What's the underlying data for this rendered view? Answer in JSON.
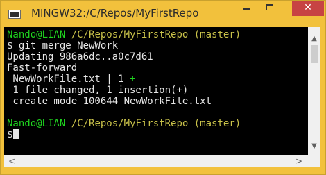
{
  "window": {
    "title": "MINGW32:/C/Repos/MyFirstRepo",
    "icon": "terminal-icon",
    "controls": {
      "minimize": "minimize-icon",
      "maximize": "maximize-icon",
      "close": "close-icon",
      "close_glyph": "✕"
    },
    "titlebar_color": "#f2c13c",
    "close_color": "#c74343"
  },
  "terminal": {
    "background": "#000000",
    "lines": [
      {
        "user": "Nando@LIAN",
        "path": "/C/Repos/MyFirstRepo",
        "branch": "(master)"
      },
      {
        "text": "$ git merge NewWork"
      },
      {
        "text": "Updating 986a6dc..a0c7d61"
      },
      {
        "text": "Fast-forward"
      },
      {
        "text": " NewWorkFile.txt | 1 ",
        "plus": "+"
      },
      {
        "text": " 1 file changed, 1 insertion(+)"
      },
      {
        "text": " create mode 100644 NewWorkFile.txt"
      },
      {
        "text": ""
      },
      {
        "user": "Nando@LIAN",
        "path": "/C/Repos/MyFirstRepo",
        "branch": "(master)"
      },
      {
        "text": "$"
      }
    ]
  },
  "scrollbars": {
    "up": "▲",
    "down": "▼",
    "left": "<",
    "right": ">"
  }
}
